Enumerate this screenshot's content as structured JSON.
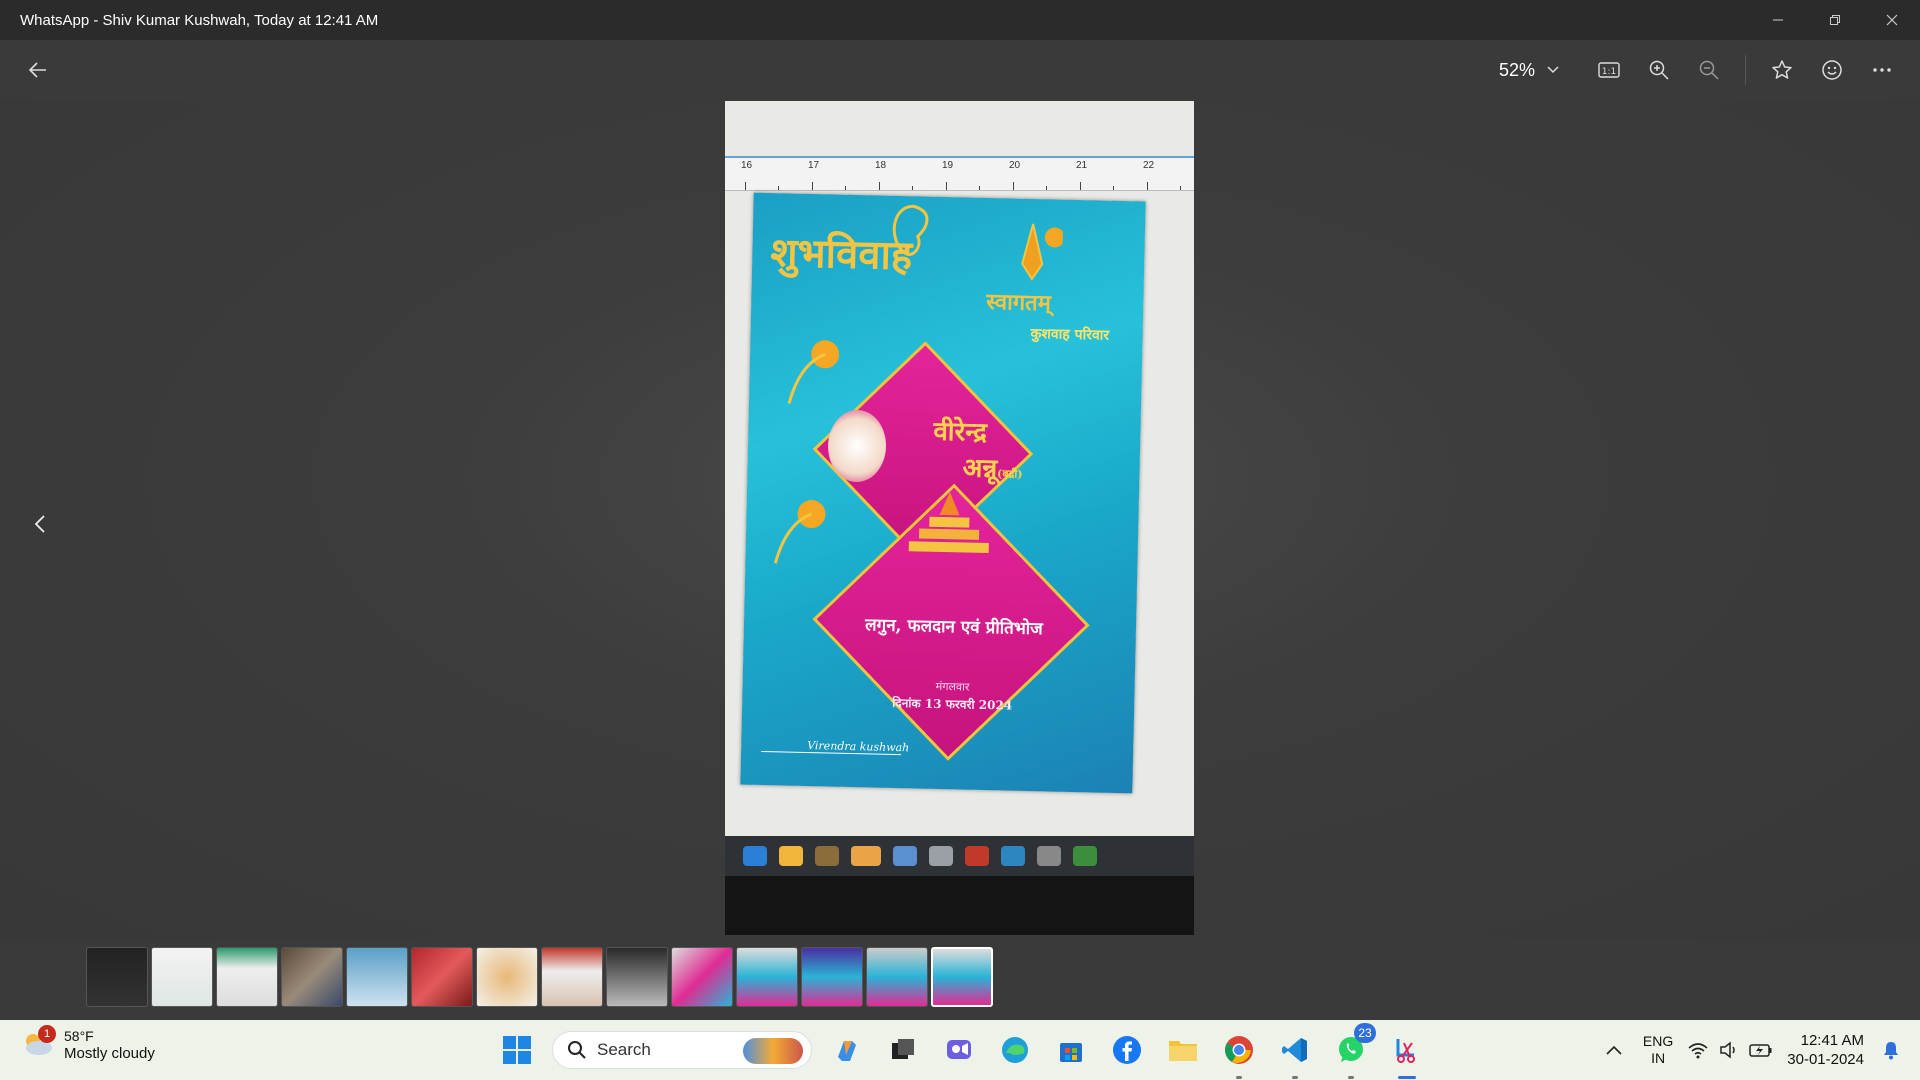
{
  "window": {
    "title": "WhatsApp - Shiv Kumar Kushwah, Today at 12:41 AM"
  },
  "toolbar": {
    "zoom_value": "52%"
  },
  "photo": {
    "ruler_labels": [
      "16",
      "17",
      "18",
      "19",
      "20",
      "21",
      "22"
    ],
    "card_title": "शुभविवाह",
    "card_welcome": "स्वागतम्",
    "card_family": "कुशवाह परिवार",
    "groom_name": "वीरेन्द्र",
    "bride_name": "अन्नू",
    "bride_suffix": "(बद्री)",
    "event_name": "लगुन, फलदान एवं प्रीतिभोज",
    "event_day": "मंगलवार",
    "event_date": "दिनांक 13 फरवरी 2024",
    "sender": "Virendra kushwah"
  },
  "filmstrip": {
    "count": 14,
    "active_index": 13
  },
  "taskbar": {
    "weather_temp": "58°F",
    "weather_desc": "Mostly cloudy",
    "weather_badge": "1",
    "search_label": "Search",
    "whatsapp_badge": "23",
    "lang_primary": "ENG",
    "lang_secondary": "IN",
    "time": "12:41 AM",
    "date": "30-01-2024"
  },
  "colors": {
    "taskbar_bg": "#eef3ea",
    "titlebar_bg": "#2b2b2b",
    "viewer_bg": "#3a3a3a",
    "accent": "#2f6fdc"
  }
}
